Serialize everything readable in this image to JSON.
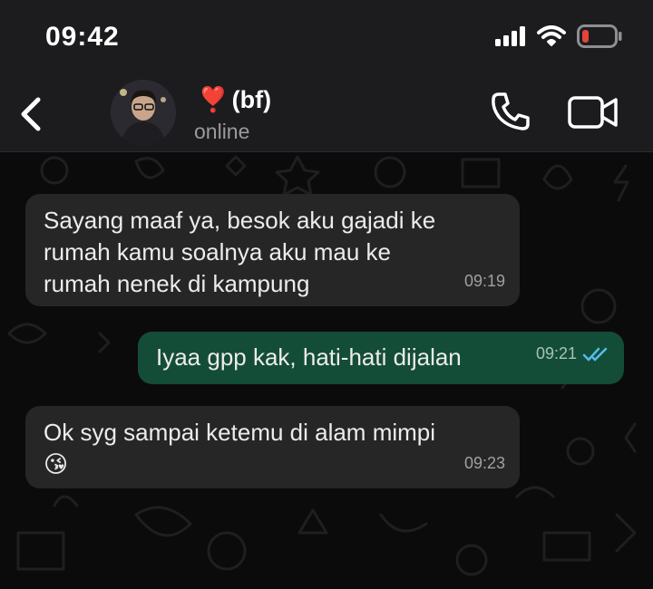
{
  "status_bar": {
    "time": "09:42"
  },
  "header": {
    "contact_name": "(bf)",
    "name_emoji": "❣️",
    "status": "online"
  },
  "colors": {
    "header_bg": "#1c1c1e",
    "incoming_bubble": "#262626",
    "outgoing_bubble": "#144d37",
    "read_ticks": "#53bdeb",
    "battery_low": "#e5443a"
  },
  "icons": [
    "back-chevron-icon",
    "phone-icon",
    "video-camera-icon",
    "signal-icon",
    "wifi-icon",
    "battery-low-icon",
    "double-check-icon"
  ],
  "messages": [
    {
      "direction": "incoming",
      "text": "Sayang maaf ya, besok aku gajadi ke\nrumah kamu soalnya aku mau ke\nrumah nenek di kampung",
      "time": "09:19"
    },
    {
      "direction": "outgoing",
      "text": "Iyaa gpp kak, hati-hati dijalan",
      "time": "09:21",
      "status": "read"
    },
    {
      "direction": "incoming",
      "text": "Ok syg sampai ketemu di alam mimpi",
      "emoji": "😘",
      "time": "09:23"
    }
  ]
}
